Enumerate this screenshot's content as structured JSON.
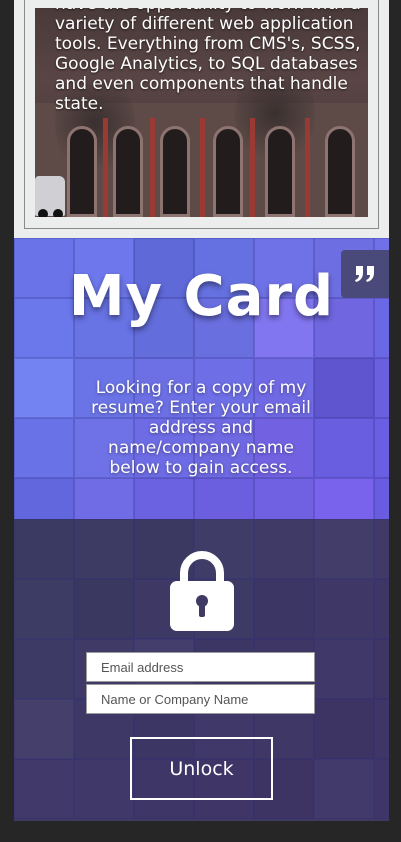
{
  "project": {
    "description": "have the opportunity to work with a variety of different web application tools. Everything from CMS's, SCSS, Google Analytics, to SQL databases and even components that handle state."
  },
  "card": {
    "title": "My Card",
    "description": "Looking for a copy of my resume? Enter your email address and name/company name below to gain access."
  },
  "quote_button": {
    "icon": "quote-icon",
    "label": "”"
  },
  "form": {
    "email_placeholder": "Email address",
    "email_value": "",
    "name_placeholder": "Name or Company Name",
    "name_value": "",
    "unlock_label": "Unlock",
    "lock_icon": "lock-icon"
  },
  "colors": {
    "page_background": "#262626",
    "card_background": "#6b6be6",
    "unlock_background": "#3f3a63",
    "quote_button": "#4a4a7a"
  }
}
